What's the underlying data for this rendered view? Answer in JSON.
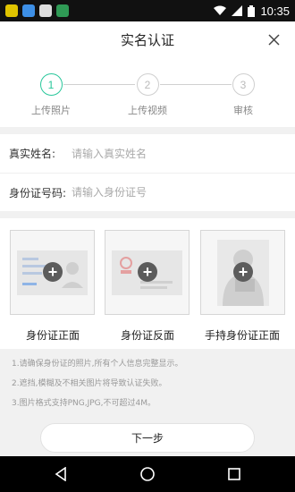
{
  "status_bar": {
    "time": "10:35",
    "left_icons": [
      "app-notification-icon",
      "shield-app-icon",
      "image-notification-icon",
      "usb-debug-icon"
    ],
    "right_icons": [
      "wifi-icon",
      "cellular-signal-icon",
      "battery-icon"
    ]
  },
  "header": {
    "title": "实名认证",
    "close_icon": "close-icon"
  },
  "steps": [
    {
      "number": "1",
      "label": "上传照片",
      "active": true
    },
    {
      "number": "2",
      "label": "上传视频",
      "active": false
    },
    {
      "number": "3",
      "label": "审核",
      "active": false
    }
  ],
  "form": {
    "name_label": "真实姓名:",
    "name_placeholder": "请输入真实姓名",
    "id_label": "身份证号码:",
    "id_placeholder": "请输入身份证号"
  },
  "uploads": [
    {
      "label": "身份证正面",
      "icon": "id-card-front-icon"
    },
    {
      "label": "身份证反面",
      "icon": "id-card-back-icon"
    },
    {
      "label": "手持身份证正面",
      "icon": "person-holding-id-icon"
    }
  ],
  "notes": [
    "1.请确保身份证的照片,所有个人信息完整显示。",
    "2.遮挡,模糊及不相关图片将导致认证失败。",
    "3.图片格式支持PNG,JPG,不可超过4M。"
  ],
  "next_button": {
    "label": "下一步"
  },
  "colors": {
    "accent": "#29c79b",
    "background": "#f1f1f1",
    "status_bar": "#111111",
    "nav_bar": "#000000"
  },
  "nav_bar": {
    "icons": [
      "back-icon",
      "home-icon",
      "recents-icon"
    ]
  }
}
